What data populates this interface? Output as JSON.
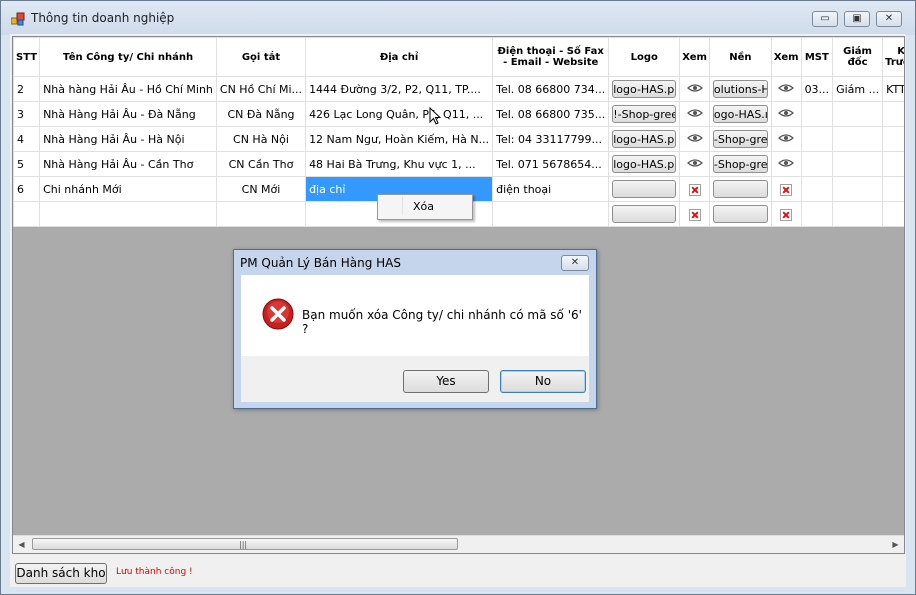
{
  "window": {
    "title": "Thông tin doanh nghiệp",
    "minimize_icon": "minimize-icon",
    "maximize_icon": "maximize-icon",
    "close_icon": "close-icon"
  },
  "grid": {
    "columns": [
      "STT",
      "Tên Công ty/ Chi nhánh",
      "Gọi tắt",
      "Địa chỉ",
      "Điện thoại - Số Fax - Email - Website",
      "Logo",
      "Xem",
      "Nền",
      "Xem",
      "MST",
      "Giám đốc",
      "KT Trưởng",
      ""
    ],
    "rows": [
      {
        "stt": "2",
        "name": "Nhà hàng Hải Âu - Hồ Chí Minh",
        "short": "CN Hồ Chí Mi...",
        "address": "1444 Đường 3/2, P2, Q11, TP....",
        "phone": "Tel. 08 66800 734...",
        "logo": "logo-HAS.pı",
        "logo_view": "eye-icon",
        "bg": "olutions-HA",
        "bg_view": "eye-icon",
        "mst": "03...",
        "director": "Giám ...",
        "chief_acc": "KTT"
      },
      {
        "stt": "3",
        "name": "Nhà Hàng Hải Âu - Đà Nẵng",
        "short": "CN Đà Nẵng",
        "address": "426 Lạc Long Quân, P5, Q11, ...",
        "phone": "Tel. 08 66800 735...",
        "logo": "!-Shop-gree",
        "logo_view": "eye-icon",
        "bg": "ogo-HAS.ı",
        "bg_view": "eye-icon",
        "mst": "",
        "director": "",
        "chief_acc": ""
      },
      {
        "stt": "4",
        "name": "Nhà Hàng Hải Âu - Hà Nội",
        "short": "CN Hà Nội",
        "address": "12 Nam Ngư, Hoàn Kiếm, Hà N...",
        "phone": "Tel: 04 33117799...",
        "logo": "logo-HAS.pı",
        "logo_view": "eye-icon",
        "bg": "-Shop-gre",
        "bg_view": "eye-icon",
        "mst": "",
        "director": "",
        "chief_acc": ""
      },
      {
        "stt": "5",
        "name": "Nhà Hàng Hải Âu - Cần Thơ",
        "short": "CN Cần Thơ",
        "address": "48 Hai Bà Trưng, Khu vực 1, ...",
        "phone": "Tel. 071 5678654...",
        "logo": "logo-HAS.pı",
        "logo_view": "eye-icon",
        "bg": "-Shop-gre",
        "bg_view": "eye-icon",
        "mst": "",
        "director": "",
        "chief_acc": ""
      },
      {
        "stt": "6",
        "name": "Chi nhánh Mới",
        "short": "CN Mới",
        "address": "địa chỉ",
        "phone": "điện thoại",
        "logo": "",
        "logo_view": "broken-image-icon",
        "bg": "",
        "bg_view": "broken-image-icon",
        "mst": "",
        "director": "",
        "chief_acc": ""
      },
      {
        "stt": "",
        "name": "",
        "short": "",
        "address": "",
        "phone": "",
        "logo": "",
        "logo_view": "broken-image-icon",
        "bg": "",
        "bg_view": "broken-image-icon",
        "mst": "",
        "director": "",
        "chief_acc": ""
      }
    ],
    "scroll_grip": "|||"
  },
  "context_menu": {
    "delete_label": "Xóa"
  },
  "dialog": {
    "title": "PM Quản Lý Bán Hàng HAS",
    "message": "Bạn muốn xóa Công ty/ chi nhánh có mã số '6' ?",
    "icon": "error-icon",
    "yes_label": "Yes",
    "no_label": "No"
  },
  "footer": {
    "warehouse_button": "Danh sách kho",
    "status": "Lưu thành công !",
    "status_color": "#e00000"
  },
  "colors": {
    "selection": "#3399ff",
    "grid_bg": "#ababab"
  }
}
